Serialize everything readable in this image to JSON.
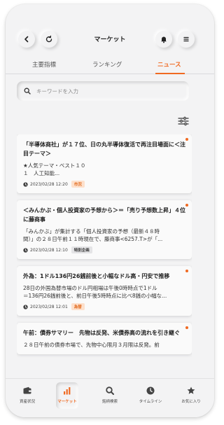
{
  "header": {
    "title": "マーケット"
  },
  "tabs": [
    {
      "label": "主要指標",
      "active": false
    },
    {
      "label": "ランキング",
      "active": false
    },
    {
      "label": "ニュース",
      "active": true
    }
  ],
  "search": {
    "placeholder": "キーワードを入力",
    "value": ""
  },
  "news": [
    {
      "title": "「半導体商社」が１７位、日の丸半導体復活で再注目場面に＜注目テーマ＞",
      "body_line1": "★人気テーマ・ベスト１０",
      "body_line2": "１　人工知能...",
      "date": "2023/02/28 12:20",
      "tag": "市況",
      "unread": true
    },
    {
      "title": "＜みんかぶ・個人投資家の予想から＞＝「売り予想数上昇」４位に藤商事",
      "body_line1": "「みんかぶ」が集計する「個人投資家の予想（最新４８時",
      "body_line2": "間）」の２８日午前１１時現在で、藤商事<6257.T>が「...",
      "date": "2023/02/28 12:10",
      "tag": "特別企画",
      "unread": true
    },
    {
      "title": "外為：1ドル136円26銭前後と小幅なドル高・円安で推移",
      "body_line1": "28日の外国為替市場のドル円相場は午後0時時点で1ドル",
      "body_line2": "＝136円26銭前後と、前日午後5時時点に比べ8銭の小幅な...",
      "date": "2023/02/28 12:01",
      "tag": "為替",
      "unread": true
    },
    {
      "title": "午前：債券サマリー　先物は反発、米債券高の流れを引き継ぐ",
      "body_line1": "２８日午前の債券市場で、先物中心限月３月限は反発。前",
      "body_line2": "",
      "date": "",
      "tag": "",
      "unread": true
    }
  ],
  "bottom_nav": [
    {
      "label": "資産状況",
      "icon": "wallet-icon",
      "active": false
    },
    {
      "label": "マーケット",
      "icon": "bar-chart-icon",
      "active": true
    },
    {
      "label": "銘柄検索",
      "icon": "search-icon",
      "active": false
    },
    {
      "label": "タイムライン",
      "icon": "clock-icon",
      "active": false
    },
    {
      "label": "お気に入り",
      "icon": "star-icon",
      "active": false
    }
  ],
  "colors": {
    "accent": "#f06a22",
    "background": "#f3f3f4",
    "card": "#fafafa"
  }
}
